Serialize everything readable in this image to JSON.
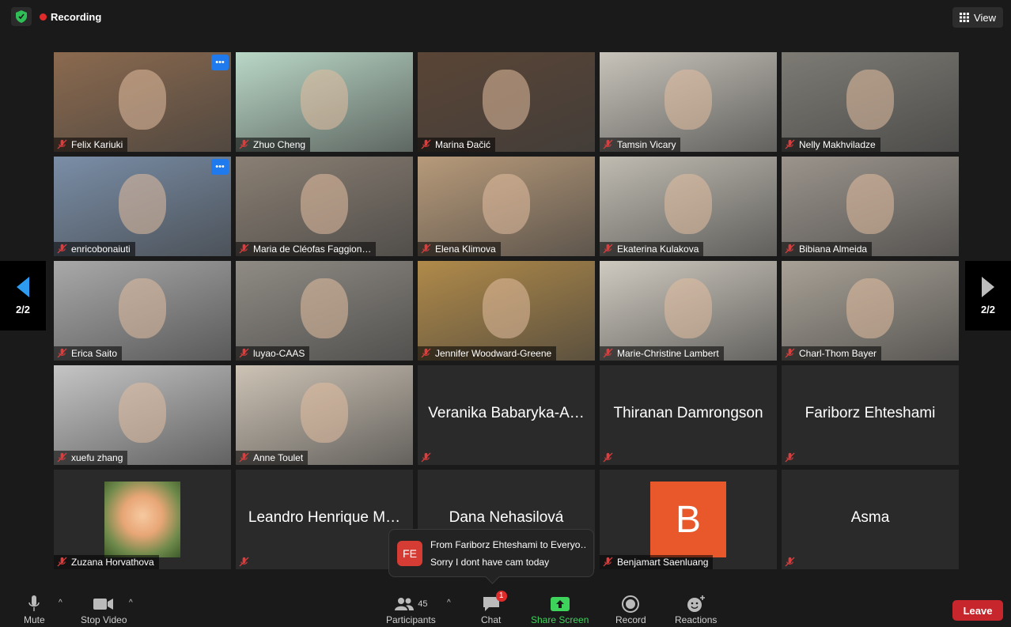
{
  "header": {
    "recording_label": "Recording",
    "view_label": "View"
  },
  "pager": {
    "left": "2/2",
    "right": "2/2"
  },
  "participants": [
    {
      "name": "Felix Kariuki",
      "video": true,
      "bg": "#8b6a4f",
      "more": true
    },
    {
      "name": "Zhuo Cheng",
      "video": true,
      "bg": "#b9d7c6"
    },
    {
      "name": "Marina Đačić",
      "video": true,
      "bg": "#5a4536"
    },
    {
      "name": "Tamsin Vicary",
      "video": true,
      "bg": "#c7c3ba"
    },
    {
      "name": "Nelly Makhviladze",
      "video": true,
      "bg": "#7d7b74"
    },
    {
      "name": "enricobonaiuti",
      "video": true,
      "bg": "#7a8ea7",
      "more": true
    },
    {
      "name": "Maria de Cléofas Faggion…",
      "video": true,
      "bg": "#8a7f73"
    },
    {
      "name": "Elena Klimova",
      "video": true,
      "bg": "#b79a7a"
    },
    {
      "name": "Ekaterina Kulakova",
      "video": true,
      "bg": "#bfbbb1"
    },
    {
      "name": "Bibiana Almeida",
      "video": true,
      "bg": "#9b948c"
    },
    {
      "name": "Erica Saito",
      "video": true,
      "bg": "#a9a9a9"
    },
    {
      "name": "luyao-CAAS",
      "video": true,
      "bg": "#8f8b84"
    },
    {
      "name": "Jennifer Woodward-Greene",
      "video": true,
      "bg": "#b08a4a"
    },
    {
      "name": "Marie-Christine Lambert",
      "video": true,
      "bg": "#cfcac0"
    },
    {
      "name": "Charl-Thom Bayer",
      "video": true,
      "bg": "#a8a196"
    },
    {
      "name": "xuefu zhang",
      "video": true,
      "bg": "#c5c5c5"
    },
    {
      "name": "Anne Toulet",
      "video": true,
      "bg": "#cdc3b5"
    },
    {
      "name": "",
      "big": "Veranika Babaryka-A…",
      "video": false
    },
    {
      "name": "",
      "big": "Thiranan Damrongson",
      "video": false
    },
    {
      "name": "",
      "big": "Fariborz Ehteshami",
      "video": false
    },
    {
      "name": "Zuzana Horvathova",
      "video": false,
      "rose": true
    },
    {
      "name": "",
      "big": "Leandro Henrique M…",
      "video": false
    },
    {
      "name": "",
      "big": "Dana Nehasilová",
      "video": false
    },
    {
      "name": "Benjamart Saenluang",
      "video": false,
      "avatar": "B"
    },
    {
      "name": "",
      "big": "Asma",
      "video": false
    }
  ],
  "chat_popup": {
    "initials": "FE",
    "from": "From Fariborz Ehteshami to Everyo…",
    "message": "Sorry I dont have cam today"
  },
  "toolbar": {
    "mute": "Mute",
    "stop_video": "Stop Video",
    "participants": "Participants",
    "participant_count": "45",
    "chat": "Chat",
    "chat_badge": "1",
    "share_screen": "Share Screen",
    "record": "Record",
    "reactions": "Reactions",
    "leave": "Leave"
  }
}
